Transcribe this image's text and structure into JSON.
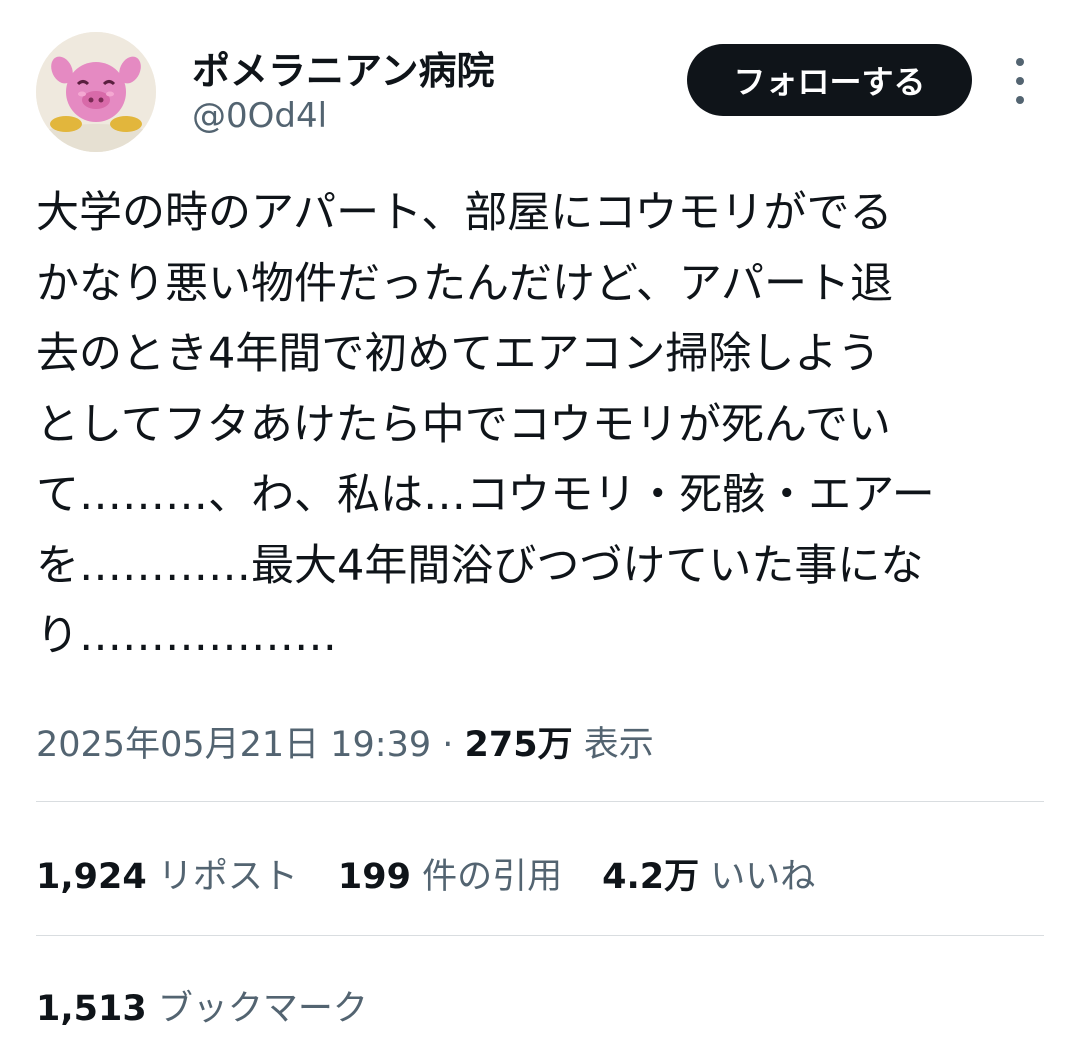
{
  "author": {
    "display_name": "ポメラニアン病院",
    "handle": "@0Od4l"
  },
  "actions": {
    "follow_label": "フォローする"
  },
  "icons": {
    "avatar": "pink-pig-character-avatar",
    "more": "more-vertical-icon"
  },
  "tweet": {
    "lines": [
      "大学の時のアパート、部屋にコウモリがでる",
      "かなり悪い物件だったんだけど、アパート退",
      "去のとき4年間で初めてエアコン掃除しよう",
      "としてフタあけたら中でコウモリが死んでい",
      "て………、わ、私は…コウモリ・死骸・エアー",
      "を…………最大4年間浴びつづけていた事にな",
      "り………………"
    ],
    "timestamp": "2025年05月21日 19:39",
    "separator": " · ",
    "views_count": "275万",
    "views_label": "表示"
  },
  "stats": {
    "reposts_count": "1,924",
    "reposts_label": "リポスト",
    "quotes_count": "199",
    "quotes_label": "件の引用",
    "likes_count": "4.2万",
    "likes_label": "いいね",
    "bookmarks_count": "1,513",
    "bookmarks_label": "ブックマーク"
  },
  "colors": {
    "text": "#0f1419",
    "secondary": "#536471",
    "button_bg": "#0f1419",
    "divider": "#d9dde0"
  }
}
